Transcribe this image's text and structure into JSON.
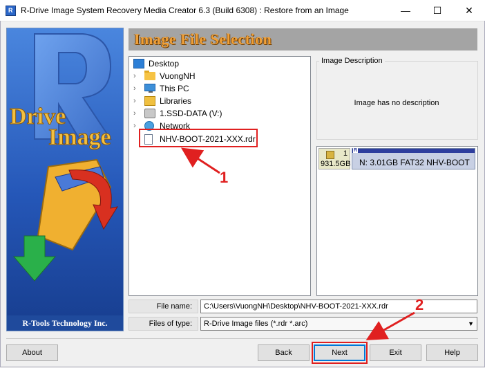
{
  "window": {
    "title": "R-Drive Image System Recovery Media Creator 6.3 (Build 6308) : Restore from an Image",
    "minimize": "—",
    "maximize": "☐",
    "close": "✕"
  },
  "sidebar": {
    "logo_line1": "Drive",
    "logo_line2": "Image",
    "logo_letter": "R",
    "footer": "R-Tools Technology Inc."
  },
  "header": {
    "title": "Image File Selection"
  },
  "tree": {
    "items": [
      {
        "label": "Desktop",
        "icon": "desktop-icon"
      },
      {
        "label": "VuongNH",
        "icon": "folder-icon"
      },
      {
        "label": "This PC",
        "icon": "computer-icon"
      },
      {
        "label": "Libraries",
        "icon": "libraries-icon"
      },
      {
        "label": "1.SSD-DATA (V:)",
        "icon": "drive-icon"
      },
      {
        "label": "Network",
        "icon": "network-icon"
      },
      {
        "label": "NHV-BOOT-2021-XXX.rdr",
        "icon": "image-file-icon"
      }
    ]
  },
  "description": {
    "label": "Image Description",
    "text": "Image has no description"
  },
  "disk": {
    "number": "1",
    "size": "931.5GB",
    "partition_letter": "R",
    "partition_text": "N:  3.01GB  FAT32  NHV-BOOT"
  },
  "form": {
    "file_name_label": "File name:",
    "file_name_value": "C:\\Users\\VuongNH\\Desktop\\NHV-BOOT-2021-XXX.rdr",
    "file_type_label": "Files of type:",
    "file_type_value": "R-Drive Image files (*.rdr *.arc)"
  },
  "buttons": {
    "about": "About",
    "back": "Back",
    "next": "Next",
    "exit": "Exit",
    "help": "Help"
  },
  "annotations": {
    "callout1": "1",
    "callout2": "2",
    "color": "#e02020"
  }
}
